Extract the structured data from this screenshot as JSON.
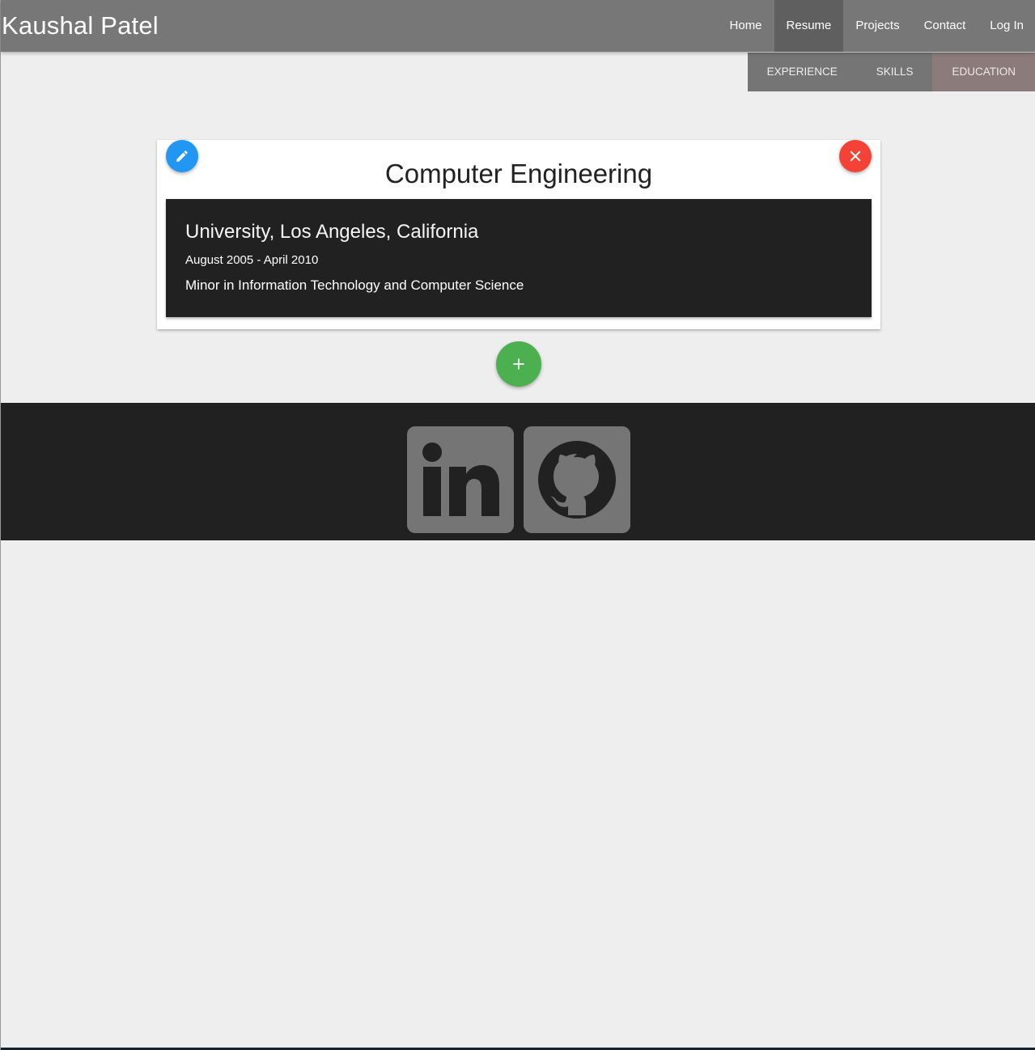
{
  "header": {
    "brand": "Kaushal Patel",
    "nav": [
      {
        "label": "Home",
        "active": false
      },
      {
        "label": "Resume",
        "active": true
      },
      {
        "label": "Projects",
        "active": false
      },
      {
        "label": "Contact",
        "active": false
      },
      {
        "label": "Log In",
        "active": false
      }
    ]
  },
  "subnav": {
    "tabs": [
      {
        "label": "EXPERIENCE",
        "active": false
      },
      {
        "label": "SKILLS",
        "active": false
      },
      {
        "label": "EDUCATION",
        "active": true
      }
    ]
  },
  "card": {
    "title": "Computer Engineering",
    "edit_icon": "pencil-icon",
    "delete_icon": "close-icon",
    "entry": {
      "school": "University, Los Angeles, California",
      "dates": "August 2005 - April 2010",
      "description": "Minor in Information Technology and Computer Science"
    }
  },
  "add_button": {
    "label": "+",
    "icon": "plus-icon"
  },
  "footer": {
    "social": [
      {
        "icon": "linkedin-icon"
      },
      {
        "icon": "github-icon"
      }
    ]
  },
  "colors": {
    "navbar": "#777777",
    "nav_active": "#5f5f5f",
    "subtab": "#757575",
    "subtab_active": "#8b7b7b",
    "edit_fab": "#2196f3",
    "delete_fab": "#f44336",
    "add_fab": "#4caf50",
    "entry_bg": "#212121",
    "footer_bg": "#212121",
    "social_icon_bg": "#757575"
  }
}
